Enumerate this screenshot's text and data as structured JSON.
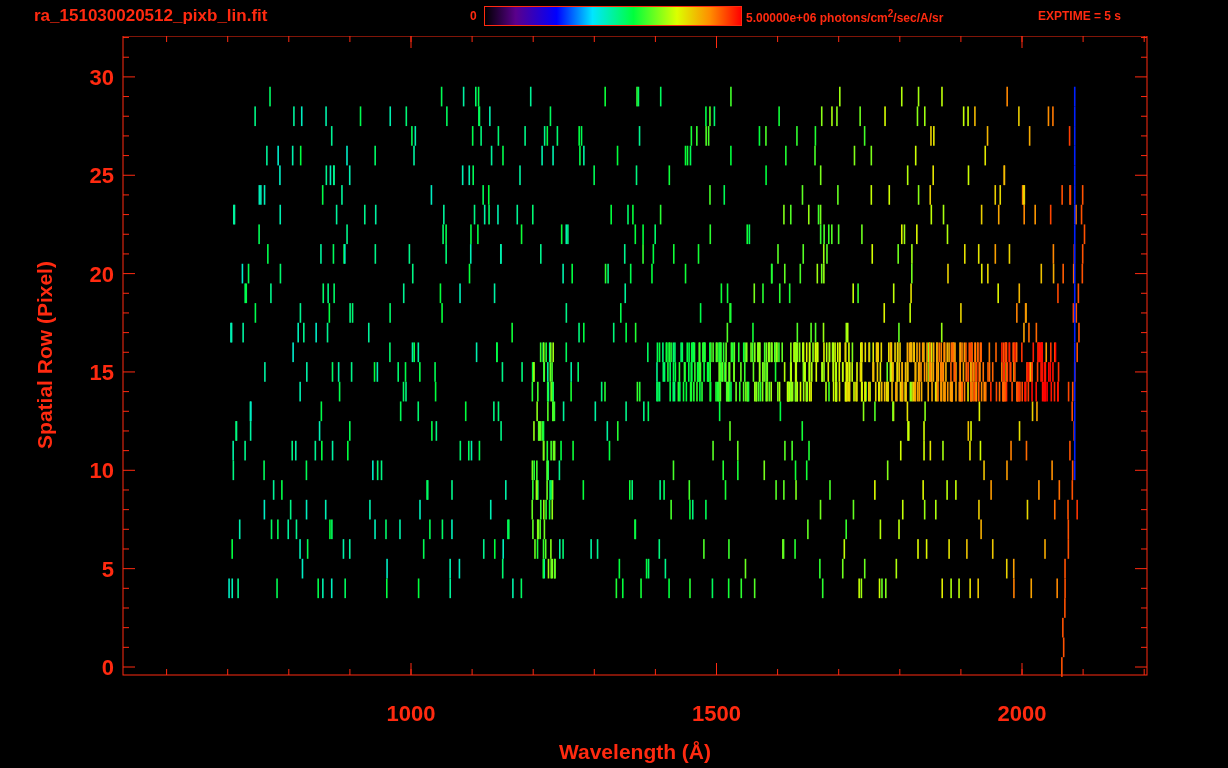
{
  "header": {
    "filename": "ra_151030020512_pixb_lin.fit",
    "colorbar": {
      "min_label": "0",
      "max_label": "5.00000e+06 photons/cm$^{2}$/sec/A/sr"
    },
    "exposure": "EXPTIME = 5 s"
  },
  "plot": {
    "xlabel": "Wavelength (Å)",
    "ylabel": "Spatial Row (Pixel)",
    "xticks": [
      "1000",
      "1500",
      "2000"
    ],
    "yticks": [
      "30",
      "25",
      "20",
      "15",
      "10",
      "5",
      "0"
    ]
  }
}
